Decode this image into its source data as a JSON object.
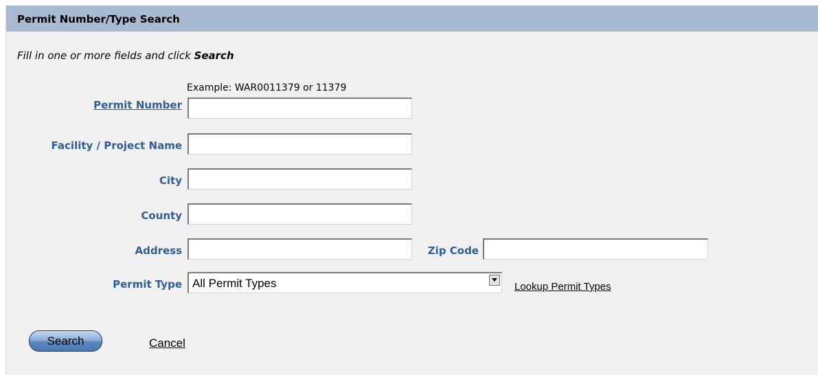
{
  "header": {
    "title": "Permit Number/Type Search"
  },
  "instructions": {
    "prefix": "Fill in one or more fields and click ",
    "emphasis": "Search"
  },
  "form": {
    "permit_number": {
      "label": "Permit Number",
      "example": "Example: WAR0011379 or 11379",
      "value": ""
    },
    "facility_name": {
      "label": "Facility / Project Name",
      "value": ""
    },
    "city": {
      "label": "City",
      "value": ""
    },
    "county": {
      "label": "County",
      "value": ""
    },
    "address": {
      "label": "Address",
      "value": ""
    },
    "zip_code": {
      "label": "Zip Code",
      "value": ""
    },
    "permit_type": {
      "label": "Permit Type",
      "selected": "All Permit Types",
      "lookup_link": "Lookup Permit Types"
    }
  },
  "actions": {
    "search_label": "Search",
    "cancel_label": "Cancel"
  },
  "colors": {
    "header_bg": "#a9bbd2",
    "panel_bg": "#f1f1f1",
    "label": "#2f5d96",
    "button": "#5c88c0"
  },
  "icons": {
    "dropdown": "chevron-down-icon"
  }
}
